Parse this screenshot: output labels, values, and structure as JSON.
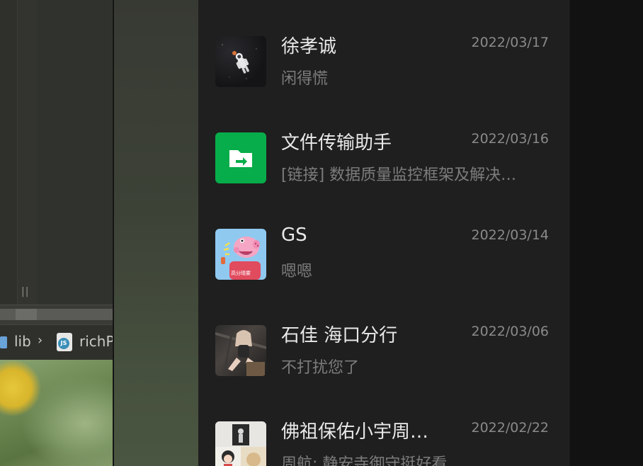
{
  "ide": {
    "breadcrumb_folder": "lib",
    "breadcrumb_separator": "›",
    "breadcrumb_file": "richP",
    "js_icon_label": "JS",
    "grip": "||"
  },
  "chats": [
    {
      "name": "徐孝诚",
      "date": "2022/03/17",
      "preview": "闲得慌",
      "avatar_icon": "astronaut-avatar"
    },
    {
      "name": "文件传输助手",
      "date": "2022/03/16",
      "preview": "[链接] 数据质量监控框架及解决…",
      "avatar_icon": "file-transfer-icon"
    },
    {
      "name": "GS",
      "date": "2022/03/14",
      "preview": "嗯嗯",
      "avatar_icon": "peppa-avatar",
      "avatar_text": "高分晴雾"
    },
    {
      "name": "石佳 海口分行",
      "date": "2022/03/06",
      "preview": "不打扰您了",
      "avatar_icon": "photo-avatar"
    },
    {
      "name": "佛祖保佑小宇周…",
      "date": "2022/02/22",
      "preview": "周航: 静安寺御守挺好看",
      "avatar_icon": "collage-avatar"
    }
  ],
  "colors": {
    "chat_bg": "#1f1f1f",
    "name": "#e9e9e9",
    "date": "#8a8a8a",
    "preview": "#7c7c7c",
    "file_green": "#07ad4a"
  }
}
